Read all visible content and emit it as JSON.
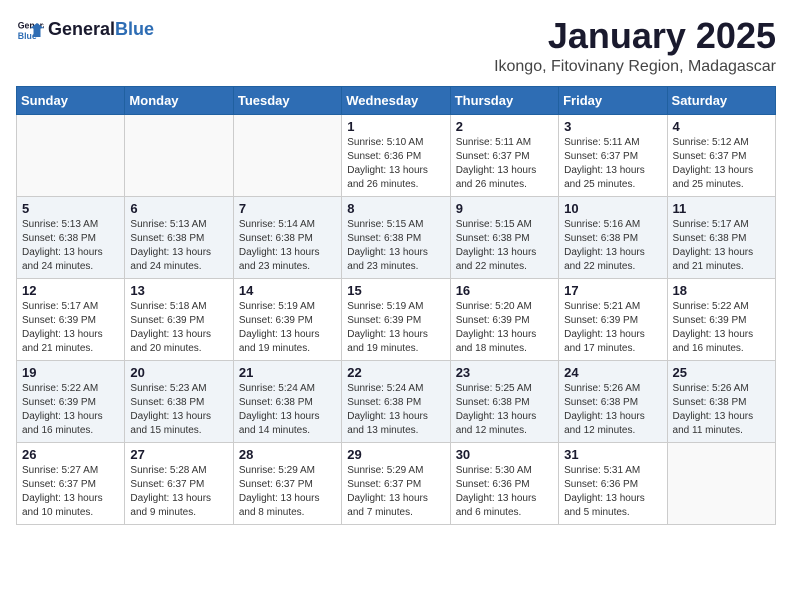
{
  "header": {
    "logo_line1": "General",
    "logo_line2": "Blue",
    "month_year": "January 2025",
    "location": "Ikongo, Fitovinany Region, Madagascar"
  },
  "weekdays": [
    "Sunday",
    "Monday",
    "Tuesday",
    "Wednesday",
    "Thursday",
    "Friday",
    "Saturday"
  ],
  "weeks": [
    [
      {
        "day": "",
        "info": ""
      },
      {
        "day": "",
        "info": ""
      },
      {
        "day": "",
        "info": ""
      },
      {
        "day": "1",
        "info": "Sunrise: 5:10 AM\nSunset: 6:36 PM\nDaylight: 13 hours\nand 26 minutes."
      },
      {
        "day": "2",
        "info": "Sunrise: 5:11 AM\nSunset: 6:37 PM\nDaylight: 13 hours\nand 26 minutes."
      },
      {
        "day": "3",
        "info": "Sunrise: 5:11 AM\nSunset: 6:37 PM\nDaylight: 13 hours\nand 25 minutes."
      },
      {
        "day": "4",
        "info": "Sunrise: 5:12 AM\nSunset: 6:37 PM\nDaylight: 13 hours\nand 25 minutes."
      }
    ],
    [
      {
        "day": "5",
        "info": "Sunrise: 5:13 AM\nSunset: 6:38 PM\nDaylight: 13 hours\nand 24 minutes."
      },
      {
        "day": "6",
        "info": "Sunrise: 5:13 AM\nSunset: 6:38 PM\nDaylight: 13 hours\nand 24 minutes."
      },
      {
        "day": "7",
        "info": "Sunrise: 5:14 AM\nSunset: 6:38 PM\nDaylight: 13 hours\nand 23 minutes."
      },
      {
        "day": "8",
        "info": "Sunrise: 5:15 AM\nSunset: 6:38 PM\nDaylight: 13 hours\nand 23 minutes."
      },
      {
        "day": "9",
        "info": "Sunrise: 5:15 AM\nSunset: 6:38 PM\nDaylight: 13 hours\nand 22 minutes."
      },
      {
        "day": "10",
        "info": "Sunrise: 5:16 AM\nSunset: 6:38 PM\nDaylight: 13 hours\nand 22 minutes."
      },
      {
        "day": "11",
        "info": "Sunrise: 5:17 AM\nSunset: 6:38 PM\nDaylight: 13 hours\nand 21 minutes."
      }
    ],
    [
      {
        "day": "12",
        "info": "Sunrise: 5:17 AM\nSunset: 6:39 PM\nDaylight: 13 hours\nand 21 minutes."
      },
      {
        "day": "13",
        "info": "Sunrise: 5:18 AM\nSunset: 6:39 PM\nDaylight: 13 hours\nand 20 minutes."
      },
      {
        "day": "14",
        "info": "Sunrise: 5:19 AM\nSunset: 6:39 PM\nDaylight: 13 hours\nand 19 minutes."
      },
      {
        "day": "15",
        "info": "Sunrise: 5:19 AM\nSunset: 6:39 PM\nDaylight: 13 hours\nand 19 minutes."
      },
      {
        "day": "16",
        "info": "Sunrise: 5:20 AM\nSunset: 6:39 PM\nDaylight: 13 hours\nand 18 minutes."
      },
      {
        "day": "17",
        "info": "Sunrise: 5:21 AM\nSunset: 6:39 PM\nDaylight: 13 hours\nand 17 minutes."
      },
      {
        "day": "18",
        "info": "Sunrise: 5:22 AM\nSunset: 6:39 PM\nDaylight: 13 hours\nand 16 minutes."
      }
    ],
    [
      {
        "day": "19",
        "info": "Sunrise: 5:22 AM\nSunset: 6:39 PM\nDaylight: 13 hours\nand 16 minutes."
      },
      {
        "day": "20",
        "info": "Sunrise: 5:23 AM\nSunset: 6:38 PM\nDaylight: 13 hours\nand 15 minutes."
      },
      {
        "day": "21",
        "info": "Sunrise: 5:24 AM\nSunset: 6:38 PM\nDaylight: 13 hours\nand 14 minutes."
      },
      {
        "day": "22",
        "info": "Sunrise: 5:24 AM\nSunset: 6:38 PM\nDaylight: 13 hours\nand 13 minutes."
      },
      {
        "day": "23",
        "info": "Sunrise: 5:25 AM\nSunset: 6:38 PM\nDaylight: 13 hours\nand 12 minutes."
      },
      {
        "day": "24",
        "info": "Sunrise: 5:26 AM\nSunset: 6:38 PM\nDaylight: 13 hours\nand 12 minutes."
      },
      {
        "day": "25",
        "info": "Sunrise: 5:26 AM\nSunset: 6:38 PM\nDaylight: 13 hours\nand 11 minutes."
      }
    ],
    [
      {
        "day": "26",
        "info": "Sunrise: 5:27 AM\nSunset: 6:37 PM\nDaylight: 13 hours\nand 10 minutes."
      },
      {
        "day": "27",
        "info": "Sunrise: 5:28 AM\nSunset: 6:37 PM\nDaylight: 13 hours\nand 9 minutes."
      },
      {
        "day": "28",
        "info": "Sunrise: 5:29 AM\nSunset: 6:37 PM\nDaylight: 13 hours\nand 8 minutes."
      },
      {
        "day": "29",
        "info": "Sunrise: 5:29 AM\nSunset: 6:37 PM\nDaylight: 13 hours\nand 7 minutes."
      },
      {
        "day": "30",
        "info": "Sunrise: 5:30 AM\nSunset: 6:36 PM\nDaylight: 13 hours\nand 6 minutes."
      },
      {
        "day": "31",
        "info": "Sunrise: 5:31 AM\nSunset: 6:36 PM\nDaylight: 13 hours\nand 5 minutes."
      },
      {
        "day": "",
        "info": ""
      }
    ]
  ]
}
